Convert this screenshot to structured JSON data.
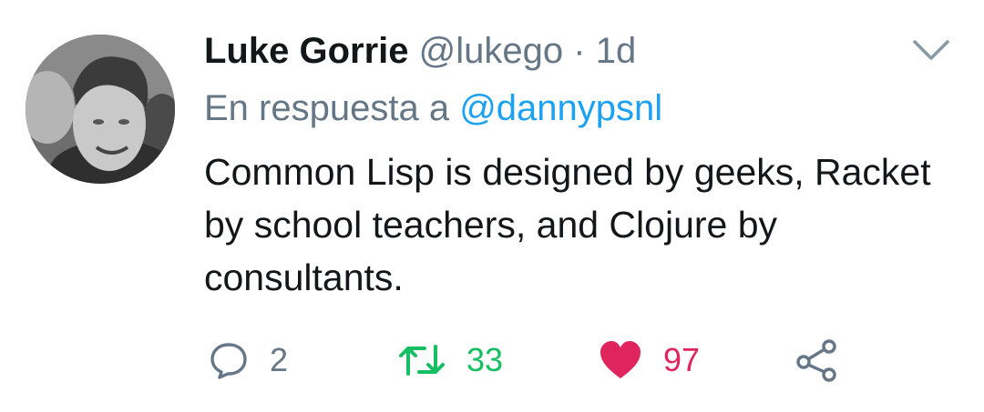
{
  "tweet": {
    "author_name": "Luke Gorrie",
    "author_handle": "@lukego",
    "separator": "·",
    "time": "1d",
    "reply_prefix": "En respuesta a",
    "reply_to": "@dannypsnl",
    "text": "Common Lisp is designed by geeks, Racket by school teachers, and Clojure by consultants.",
    "counts": {
      "replies": "2",
      "retweets": "33",
      "likes": "97"
    },
    "liked": true
  },
  "icons": {
    "menu": "chevron-down-icon",
    "reply": "speech-bubble-icon",
    "retweet": "retweet-icon",
    "like": "heart-icon",
    "share": "share-icon"
  },
  "colors": {
    "text": "#14171a",
    "secondary": "#657786",
    "link": "#1da1f2",
    "retweet": "#17bf63",
    "like": "#e0245e"
  }
}
